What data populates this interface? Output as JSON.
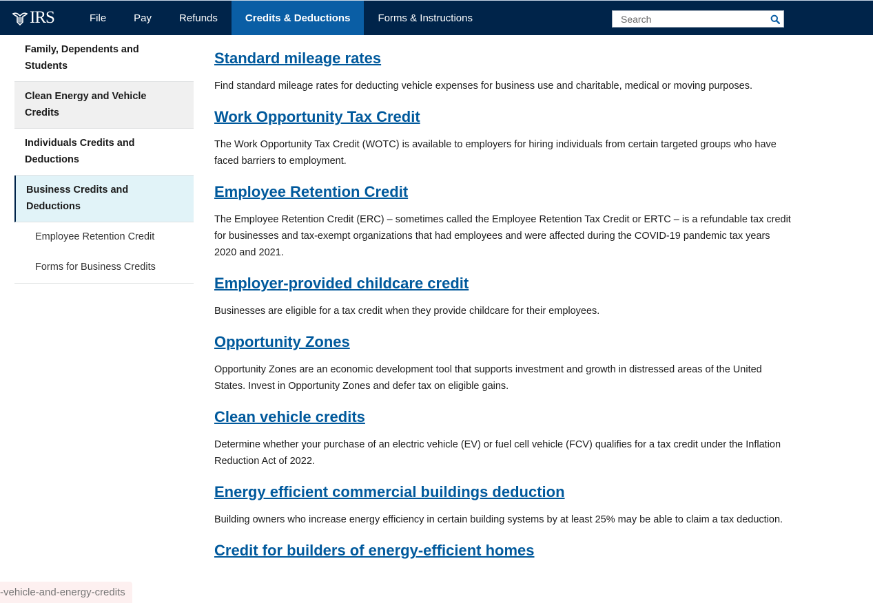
{
  "header": {
    "logo_text": "IRS",
    "logo_icon": "eagle-seal-icon",
    "nav": [
      {
        "label": "File"
      },
      {
        "label": "Pay"
      },
      {
        "label": "Refunds"
      },
      {
        "label": "Credits & Deductions"
      },
      {
        "label": "Forms & Instructions"
      }
    ],
    "search": {
      "placeholder": "Search",
      "icon": "search-icon"
    },
    "colors": {
      "bar": "#00244a",
      "active": "#0a5ea5"
    }
  },
  "sidebar": {
    "items": [
      {
        "label": "Family, Dependents and Students"
      },
      {
        "label": "Clean Energy and Vehicle Credits"
      },
      {
        "label": "Individuals Credits and Deductions"
      },
      {
        "label": "Business Credits and Deductions"
      }
    ],
    "subitems": [
      {
        "label": "Employee Retention Credit"
      },
      {
        "label": "Forms for Business Credits"
      }
    ]
  },
  "main": {
    "entries": [
      {
        "title": "Standard mileage rates",
        "description": "Find standard mileage rates for deducting vehicle expenses for business use and charitable, medical or moving purposes."
      },
      {
        "title": "Work Opportunity Tax Credit",
        "description": "The Work Opportunity Tax Credit (WOTC) is available to employers for hiring individuals from certain targeted groups who have faced barriers to employment."
      },
      {
        "title": "Employee Retention Credit",
        "description": "The Employee Retention Credit (ERC) – sometimes called the Employee Retention Tax Credit or ERTC – is a refundable tax credit for businesses and tax-exempt organizations that had employees and were affected during the COVID-19 pandemic tax years 2020 and 2021."
      },
      {
        "title": "Employer-provided childcare credit",
        "description": "Businesses are eligible for a tax credit when they provide childcare for their employees."
      },
      {
        "title": "Opportunity Zones",
        "description": "Opportunity Zones are an economic development tool that supports investment and growth in distressed areas of the United States. Invest in Opportunity Zones and defer tax on eligible gains."
      },
      {
        "title": "Clean vehicle credits",
        "description": "Determine whether your purchase of an electric vehicle (EV) or fuel cell vehicle (FCV) qualifies for a tax credit under the Inflation Reduction Act of 2022."
      },
      {
        "title": "Energy efficient commercial buildings deduction",
        "description": "Building owners who increase energy efficiency in certain building systems by at least 25% may be able to claim a tax deduction."
      },
      {
        "title": "Credit for builders of energy-efficient homes",
        "description": ""
      }
    ],
    "link_color": "#00599c"
  },
  "statusbar": {
    "text": "-vehicle-and-energy-credits"
  }
}
